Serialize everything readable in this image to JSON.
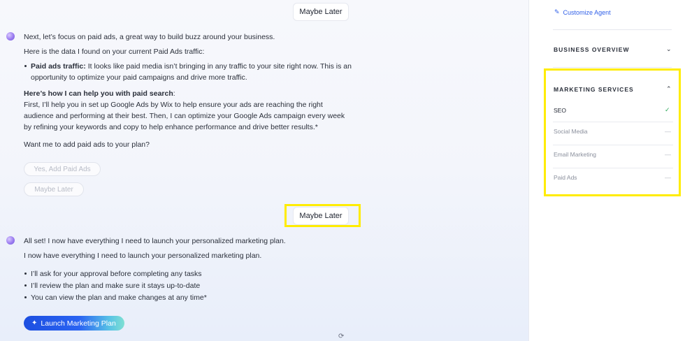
{
  "chat": {
    "user_replies": [
      "Maybe Later",
      "Maybe Later"
    ],
    "message1": {
      "intro": "Next, let’s focus on paid ads, a great way to build buzz around your business.",
      "data_line": "Here is the data I found on your current Paid Ads traffic:",
      "bullet_label": "Paid ads traffic:",
      "bullet_text": "It looks like paid media isn’t bringing in any traffic to your site right now. This is an opportunity to optimize your paid campaigns and drive more traffic.",
      "help_heading": "Here’s how I can help you with paid search",
      "help_heading_colon": ":",
      "help_text": "First, I’ll help you in set up Google Ads by Wix to help ensure your ads are reaching the right audience and performing at their best. Then, I can optimize your Google Ads campaign every week by refining your keywords and copy to help enhance performance and drive better results.*",
      "question": "Want me to add paid ads to your plan?",
      "options": [
        "Yes, Add Paid Ads",
        "Maybe Later"
      ]
    },
    "message2": {
      "line1": "All set! I now have everything I need to launch your personalized marketing plan.",
      "line2": "I now have everything I need to launch your personalized marketing plan.",
      "bullets": [
        "I’ll ask for your approval before completing any tasks",
        "I’ll review the plan and make sure it stays up-to-date",
        "You can view the plan and make changes at any time*"
      ],
      "launch_label": "Launch Marketing Plan"
    }
  },
  "sidebar": {
    "customize_label": "Customize Agent",
    "business_overview": "BUSINESS OVERVIEW",
    "marketing_services": "MARKETING SERVICES",
    "services": [
      {
        "label": "SEO",
        "status": "✓"
      },
      {
        "label": "Social Media",
        "status": "—"
      },
      {
        "label": "Email Marketing",
        "status": "—"
      },
      {
        "label": "Paid Ads",
        "status": "—"
      }
    ]
  },
  "colors": {
    "accent_blue": "#2f5fe8",
    "highlight_yellow": "#ffec00",
    "check_green": "#2ba85a"
  },
  "icons": {
    "pen": "pencil-icon",
    "chevron_down": "chevron-down-icon",
    "chevron_up": "chevron-up-icon",
    "sparkle": "sparkle-icon",
    "refresh": "refresh-icon"
  }
}
